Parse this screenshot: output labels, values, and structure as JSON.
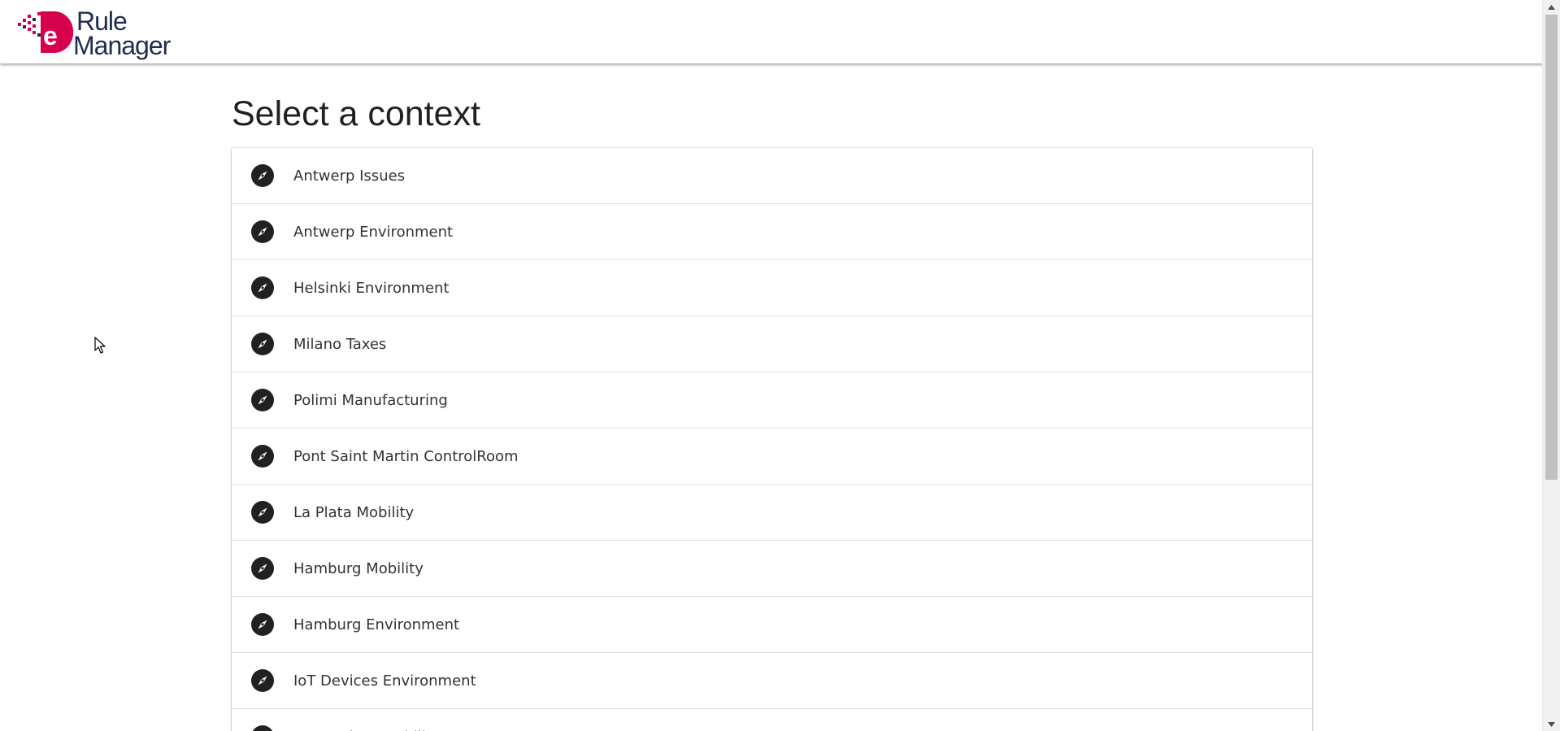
{
  "app": {
    "logo_line1": "Rule",
    "logo_line2": "Manager",
    "brand_color": "#d6004e",
    "text_color": "#1f2d4e"
  },
  "page": {
    "title": "Select a context"
  },
  "contexts": [
    {
      "label": "Antwerp Issues",
      "icon": "compass-icon"
    },
    {
      "label": "Antwerp Environment",
      "icon": "compass-icon"
    },
    {
      "label": "Helsinki Environment",
      "icon": "compass-icon"
    },
    {
      "label": "Milano Taxes",
      "icon": "compass-icon"
    },
    {
      "label": "Polimi Manufacturing",
      "icon": "compass-icon"
    },
    {
      "label": "Pont Saint Martin ControlRoom",
      "icon": "compass-icon"
    },
    {
      "label": "La Plata Mobility",
      "icon": "compass-icon"
    },
    {
      "label": "Hamburg Mobility",
      "icon": "compass-icon"
    },
    {
      "label": "Hamburg Environment",
      "icon": "compass-icon"
    },
    {
      "label": "IoT Devices Environment",
      "icon": "compass-icon"
    },
    {
      "label": "IoT Devices Mobility",
      "icon": "compass-icon"
    }
  ]
}
